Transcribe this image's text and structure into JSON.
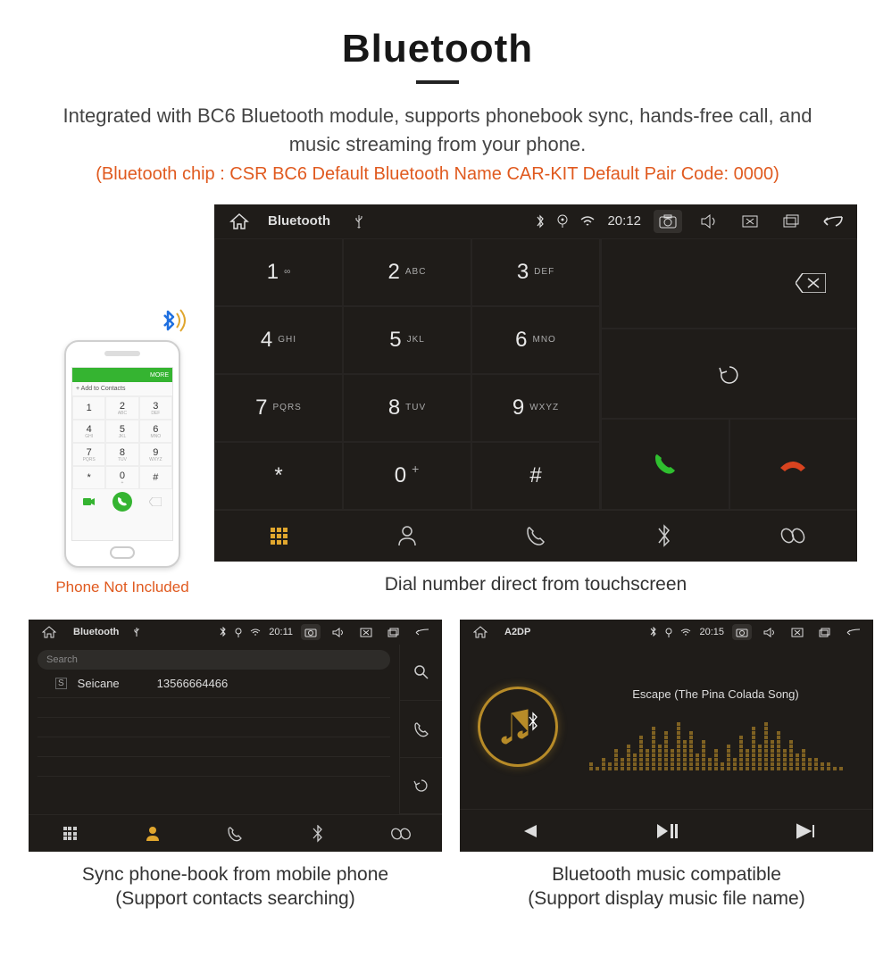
{
  "header": {
    "title": "Bluetooth",
    "description": "Integrated with BC6 Bluetooth module, supports phonebook sync, hands-free call, and music streaming from your phone.",
    "spec": "(Bluetooth chip : CSR BC6     Default Bluetooth Name CAR-KIT     Default Pair Code: 0000)"
  },
  "phone": {
    "topbar": "MORE",
    "addrow": "+   Add to Contacts",
    "keys": [
      {
        "n": "1",
        "l": ""
      },
      {
        "n": "2",
        "l": "ABC"
      },
      {
        "n": "3",
        "l": "DEF"
      },
      {
        "n": "4",
        "l": "GHI"
      },
      {
        "n": "5",
        "l": "JKL"
      },
      {
        "n": "6",
        "l": "MNO"
      },
      {
        "n": "7",
        "l": "PQRS"
      },
      {
        "n": "8",
        "l": "TUV"
      },
      {
        "n": "9",
        "l": "WXYZ"
      },
      {
        "n": "*",
        "l": ""
      },
      {
        "n": "0",
        "l": "+"
      },
      {
        "n": "#",
        "l": ""
      }
    ],
    "not_included": "Phone Not Included"
  },
  "main_device": {
    "status": {
      "title": "Bluetooth",
      "time": "20:12"
    },
    "keys": [
      {
        "n": "1",
        "l": "∞"
      },
      {
        "n": "2",
        "l": "ABC"
      },
      {
        "n": "3",
        "l": "DEF"
      },
      {
        "n": "4",
        "l": "GHI"
      },
      {
        "n": "5",
        "l": "JKL"
      },
      {
        "n": "6",
        "l": "MNO"
      },
      {
        "n": "7",
        "l": "PQRS"
      },
      {
        "n": "8",
        "l": "TUV"
      },
      {
        "n": "9",
        "l": "WXYZ"
      },
      {
        "n": "*",
        "l": ""
      },
      {
        "n": "0",
        "l": "",
        "sup": "+"
      },
      {
        "n": "#",
        "l": ""
      }
    ],
    "caption": "Dial number direct from touchscreen"
  },
  "contacts_device": {
    "status": {
      "title": "Bluetooth",
      "time": "20:11"
    },
    "search_placeholder": "Search",
    "contact": {
      "badge": "S",
      "name": "Seicane",
      "number": "13566664466"
    },
    "caption_line1": "Sync phone-book from mobile phone",
    "caption_line2": "(Support contacts searching)"
  },
  "music_device": {
    "status": {
      "title": "A2DP",
      "time": "20:15"
    },
    "song": "Escape (The Pina Colada Song)",
    "caption_line1": "Bluetooth music compatible",
    "caption_line2": "(Support display music file name)"
  }
}
